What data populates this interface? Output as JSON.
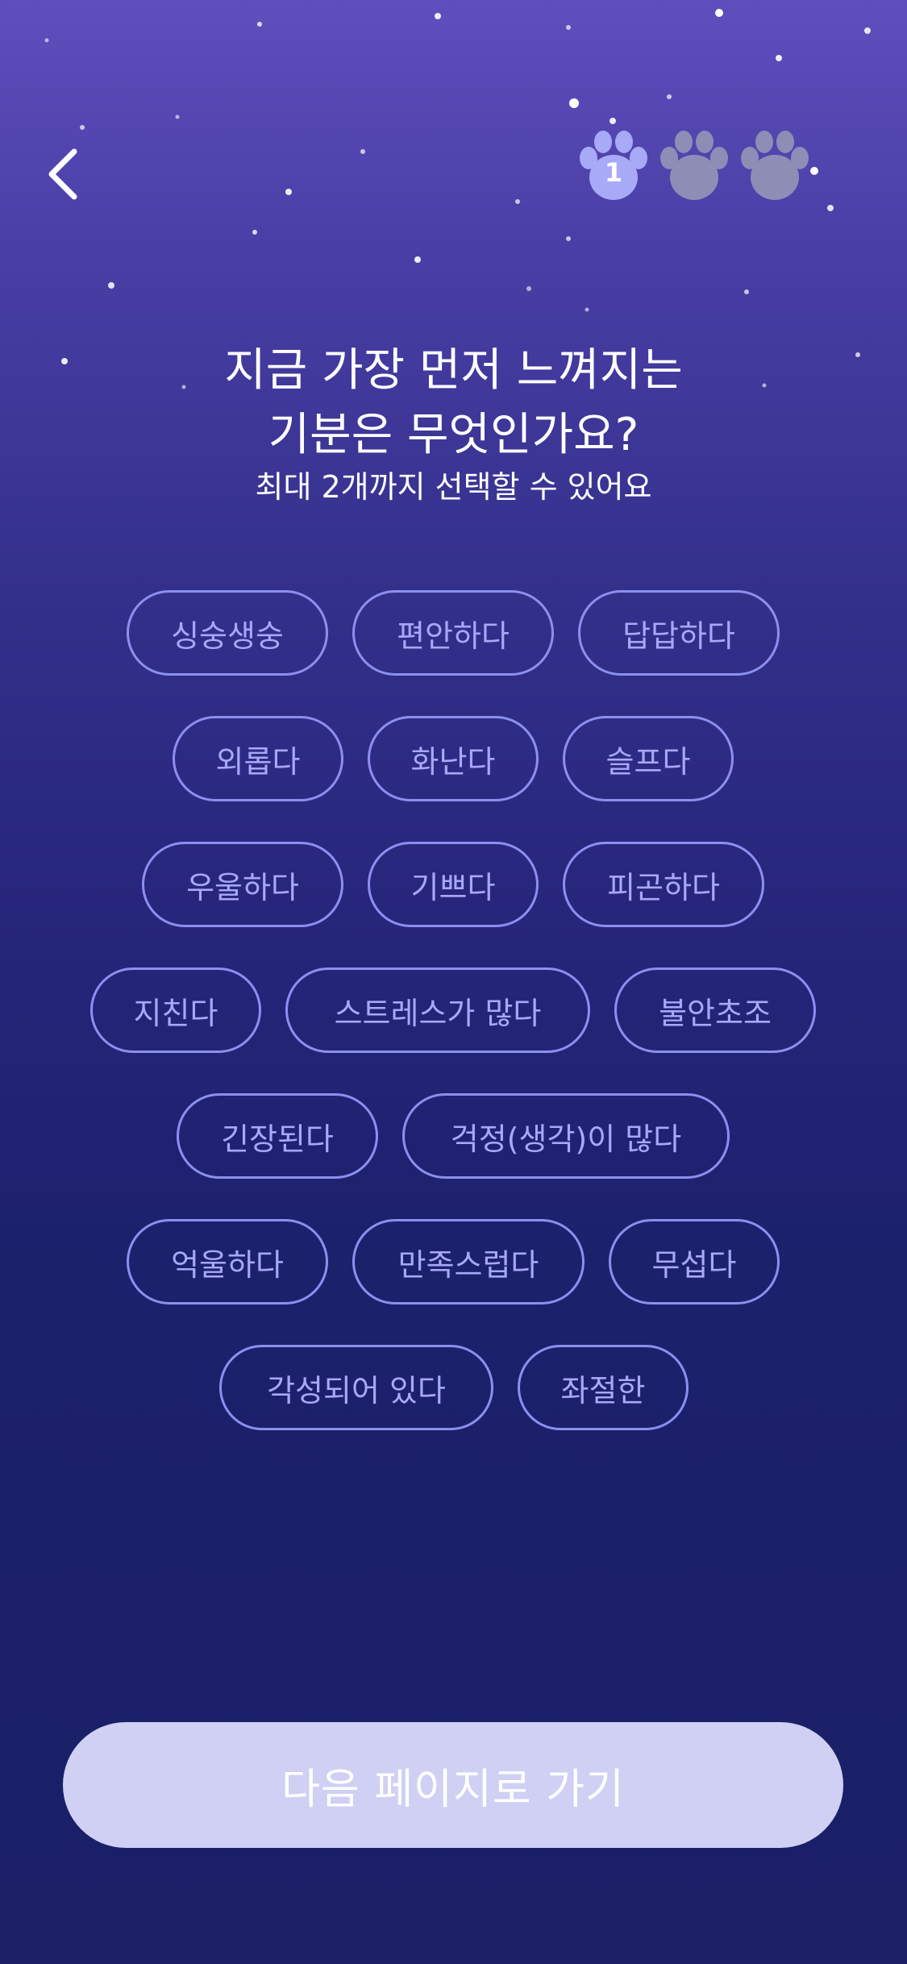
{
  "header": {
    "back_icon": "chevron-left-icon",
    "progress": {
      "current_step": "1",
      "total_steps": 3,
      "icon": "paw-icon",
      "active_color": "#a8a9f7",
      "inactive_color": "#8e8db6"
    }
  },
  "question": {
    "title_line1": "지금 가장 먼저 느껴지는",
    "title_line2": "기분은 무엇인가요?",
    "subtitle": "최대 2개까지 선택할 수 있어요"
  },
  "emotions": {
    "items": [
      "싱숭생숭",
      "편안하다",
      "답답하다",
      "외롭다",
      "화난다",
      "슬프다",
      "우울하다",
      "기쁘다",
      "피곤하다",
      "지친다",
      "스트레스가 많다",
      "불안초조",
      "긴장된다",
      "걱정(생각)이 많다",
      "억울하다",
      "만족스럽다",
      "무섭다",
      "각성되어 있다",
      "좌절한"
    ]
  },
  "footer": {
    "next_label": "다음 페이지로 가기"
  },
  "colors": {
    "chip_border": "#8d8ff0",
    "chip_text": "#a7a8f8",
    "button_bg": "#cfd0f4",
    "bg_top": "#5e4fbd",
    "bg_bottom": "#1a1f66"
  }
}
